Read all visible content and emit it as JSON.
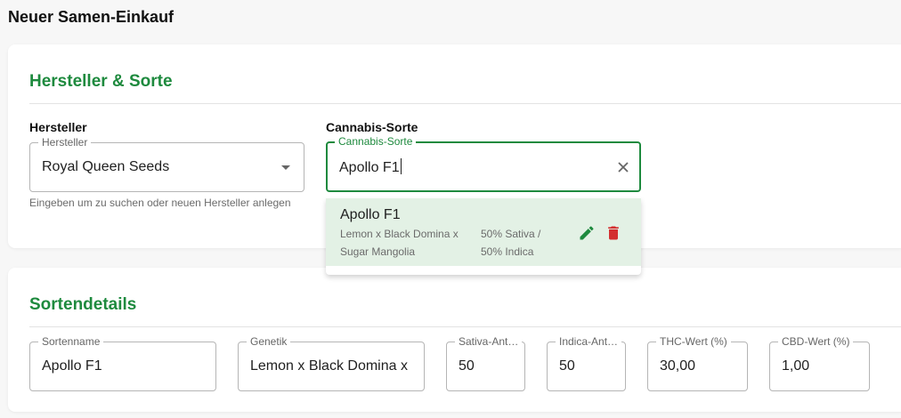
{
  "page": {
    "title": "Neuer Samen-Einkauf"
  },
  "colors": {
    "accent": "#1e8a3e",
    "danger": "#d32f2f",
    "option_highlight": "#e3f1e5"
  },
  "section1": {
    "title": "Hersteller & Sorte",
    "hersteller": {
      "heading": "Hersteller",
      "label": "Hersteller",
      "value": "Royal Queen Seeds",
      "helper": "Eingeben um zu suchen oder neuen Hersteller anlegen",
      "icon": "chevron-down-icon"
    },
    "sorte": {
      "heading": "Cannabis-Sorte",
      "label": "Cannabis-Sorte",
      "value": "Apollo F1",
      "icon": "close-icon"
    },
    "autocomplete": {
      "option": {
        "name": "Apollo F1",
        "genetics_line1": "Lemon x Black Domina x",
        "genetics_line2": "Sugar Mangolia",
        "ratio_line1": "50% Sativa /",
        "ratio_line2": "50% Indica",
        "edit_icon": "pencil-icon",
        "delete_icon": "trash-icon"
      }
    }
  },
  "section2": {
    "title": "Sortendetails",
    "fields": {
      "sortenname": {
        "label": "Sortenname",
        "value": "Apollo F1"
      },
      "genetik": {
        "label": "Genetik",
        "value": "Lemon x Black Domina x"
      },
      "sativa": {
        "label": "Sativa-Ant…",
        "value": "50"
      },
      "indica": {
        "label": "Indica-Ant…",
        "value": "50"
      },
      "thc": {
        "label": "THC-Wert (%)",
        "value": "30,00"
      },
      "cbd": {
        "label": "CBD-Wert (%)",
        "value": "1,00"
      }
    }
  }
}
